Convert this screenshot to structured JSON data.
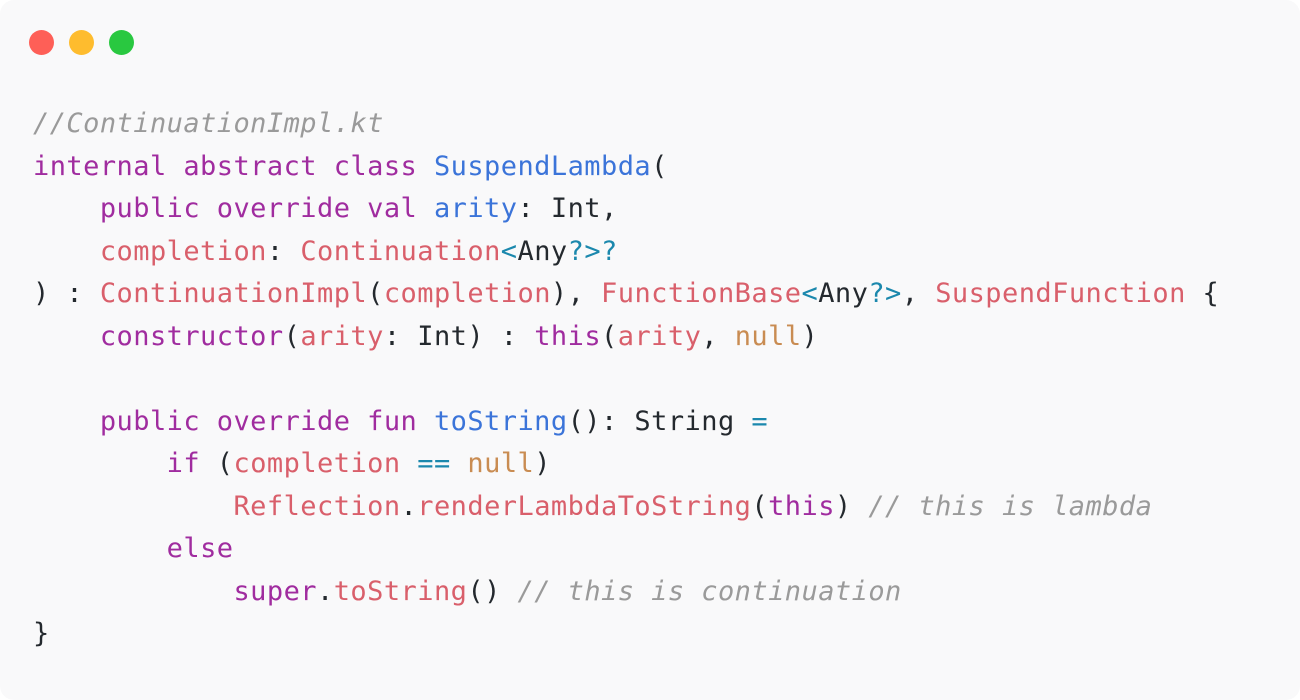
{
  "window": {
    "buttons": [
      {
        "name": "close",
        "color": "#fe5f57"
      },
      {
        "name": "minimize",
        "color": "#febc2e"
      },
      {
        "name": "zoom",
        "color": "#29c840"
      }
    ]
  },
  "code": {
    "language": "kotlin",
    "lines": [
      [
        {
          "t": "//ContinuationImpl.kt",
          "k": "comment"
        }
      ],
      [
        {
          "t": "internal abstract class ",
          "k": "keyword"
        },
        {
          "t": "SuspendLambda",
          "k": "decl"
        },
        {
          "t": "(",
          "k": "plain"
        }
      ],
      [
        {
          "t": "    ",
          "k": "plain"
        },
        {
          "t": "public override val ",
          "k": "keyword"
        },
        {
          "t": "arity",
          "k": "decl"
        },
        {
          "t": ": Int,",
          "k": "plain"
        }
      ],
      [
        {
          "t": "    ",
          "k": "plain"
        },
        {
          "t": "completion",
          "k": "type"
        },
        {
          "t": ": ",
          "k": "plain"
        },
        {
          "t": "Continuation",
          "k": "type"
        },
        {
          "t": "<",
          "k": "operator"
        },
        {
          "t": "Any",
          "k": "plain"
        },
        {
          "t": "?>?",
          "k": "operator"
        }
      ],
      [
        {
          "t": ") : ",
          "k": "plain"
        },
        {
          "t": "ContinuationImpl",
          "k": "type"
        },
        {
          "t": "(",
          "k": "plain"
        },
        {
          "t": "completion",
          "k": "type"
        },
        {
          "t": "), ",
          "k": "plain"
        },
        {
          "t": "FunctionBase",
          "k": "type"
        },
        {
          "t": "<",
          "k": "operator"
        },
        {
          "t": "Any",
          "k": "plain"
        },
        {
          "t": "?>",
          "k": "operator"
        },
        {
          "t": ", ",
          "k": "plain"
        },
        {
          "t": "SuspendFunction",
          "k": "type"
        },
        {
          "t": " {",
          "k": "plain"
        }
      ],
      [
        {
          "t": "    ",
          "k": "plain"
        },
        {
          "t": "constructor",
          "k": "keyword"
        },
        {
          "t": "(",
          "k": "plain"
        },
        {
          "t": "arity",
          "k": "type"
        },
        {
          "t": ": Int) : ",
          "k": "plain"
        },
        {
          "t": "this",
          "k": "keyword"
        },
        {
          "t": "(",
          "k": "plain"
        },
        {
          "t": "arity",
          "k": "type"
        },
        {
          "t": ", ",
          "k": "plain"
        },
        {
          "t": "null",
          "k": "literal"
        },
        {
          "t": ")",
          "k": "plain"
        }
      ],
      [
        {
          "t": "",
          "k": "plain"
        }
      ],
      [
        {
          "t": "    ",
          "k": "plain"
        },
        {
          "t": "public override fun ",
          "k": "keyword"
        },
        {
          "t": "toString",
          "k": "decl"
        },
        {
          "t": "(): String ",
          "k": "plain"
        },
        {
          "t": "=",
          "k": "operator"
        }
      ],
      [
        {
          "t": "        ",
          "k": "plain"
        },
        {
          "t": "if",
          "k": "keyword"
        },
        {
          "t": " (",
          "k": "plain"
        },
        {
          "t": "completion",
          "k": "type"
        },
        {
          "t": " ",
          "k": "plain"
        },
        {
          "t": "==",
          "k": "operator"
        },
        {
          "t": " ",
          "k": "plain"
        },
        {
          "t": "null",
          "k": "literal"
        },
        {
          "t": ")",
          "k": "plain"
        }
      ],
      [
        {
          "t": "            ",
          "k": "plain"
        },
        {
          "t": "Reflection",
          "k": "type"
        },
        {
          "t": ".",
          "k": "plain"
        },
        {
          "t": "renderLambdaToString",
          "k": "type"
        },
        {
          "t": "(",
          "k": "plain"
        },
        {
          "t": "this",
          "k": "keyword"
        },
        {
          "t": ") ",
          "k": "plain"
        },
        {
          "t": "// this is lambda",
          "k": "comment"
        }
      ],
      [
        {
          "t": "        ",
          "k": "plain"
        },
        {
          "t": "else",
          "k": "keyword"
        }
      ],
      [
        {
          "t": "            ",
          "k": "plain"
        },
        {
          "t": "super",
          "k": "keyword"
        },
        {
          "t": ".",
          "k": "plain"
        },
        {
          "t": "toString",
          "k": "type"
        },
        {
          "t": "() ",
          "k": "plain"
        },
        {
          "t": "// this is continuation",
          "k": "comment"
        }
      ],
      [
        {
          "t": "}",
          "k": "plain"
        }
      ]
    ]
  }
}
